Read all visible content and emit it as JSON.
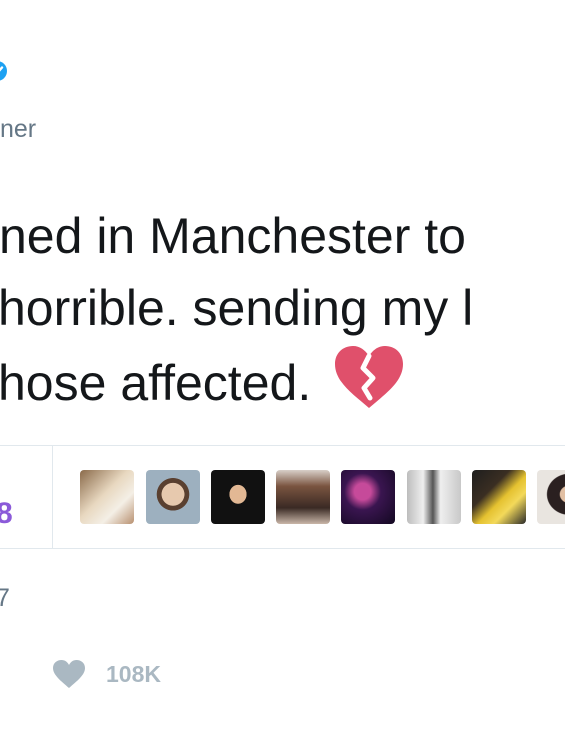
{
  "tweet": {
    "handle_partial": "ner",
    "text_lines": [
      "ned in Manchester to",
      "horrible. sending my l",
      "hose affected."
    ],
    "emoji": "broken-heart-emoji",
    "stats": {
      "likes_partial": "8"
    },
    "liked_by_avatars": [
      {
        "name": "avatar-1",
        "color": "#c9a57f"
      },
      {
        "name": "avatar-2",
        "color": "#8a9aa7"
      },
      {
        "name": "avatar-3",
        "color": "#1a1a1a"
      },
      {
        "name": "avatar-4",
        "color": "#6b4a3a"
      },
      {
        "name": "avatar-5",
        "color": "#4a2a5c"
      },
      {
        "name": "avatar-6",
        "color": "#b9b9b9"
      },
      {
        "name": "avatar-7",
        "color": "#7a5a3a"
      },
      {
        "name": "avatar-8",
        "color": "#d9d9d9"
      }
    ],
    "date_partial": "7",
    "actions": {
      "like_count": "108K"
    }
  },
  "colors": {
    "text": "#14171a",
    "secondary": "#657786",
    "verified": "#1da1f2",
    "stat_accent": "#8b5ad9",
    "action_icon": "#aab8c2",
    "divider": "#e1e8ed",
    "broken_heart": "#e0506b"
  }
}
